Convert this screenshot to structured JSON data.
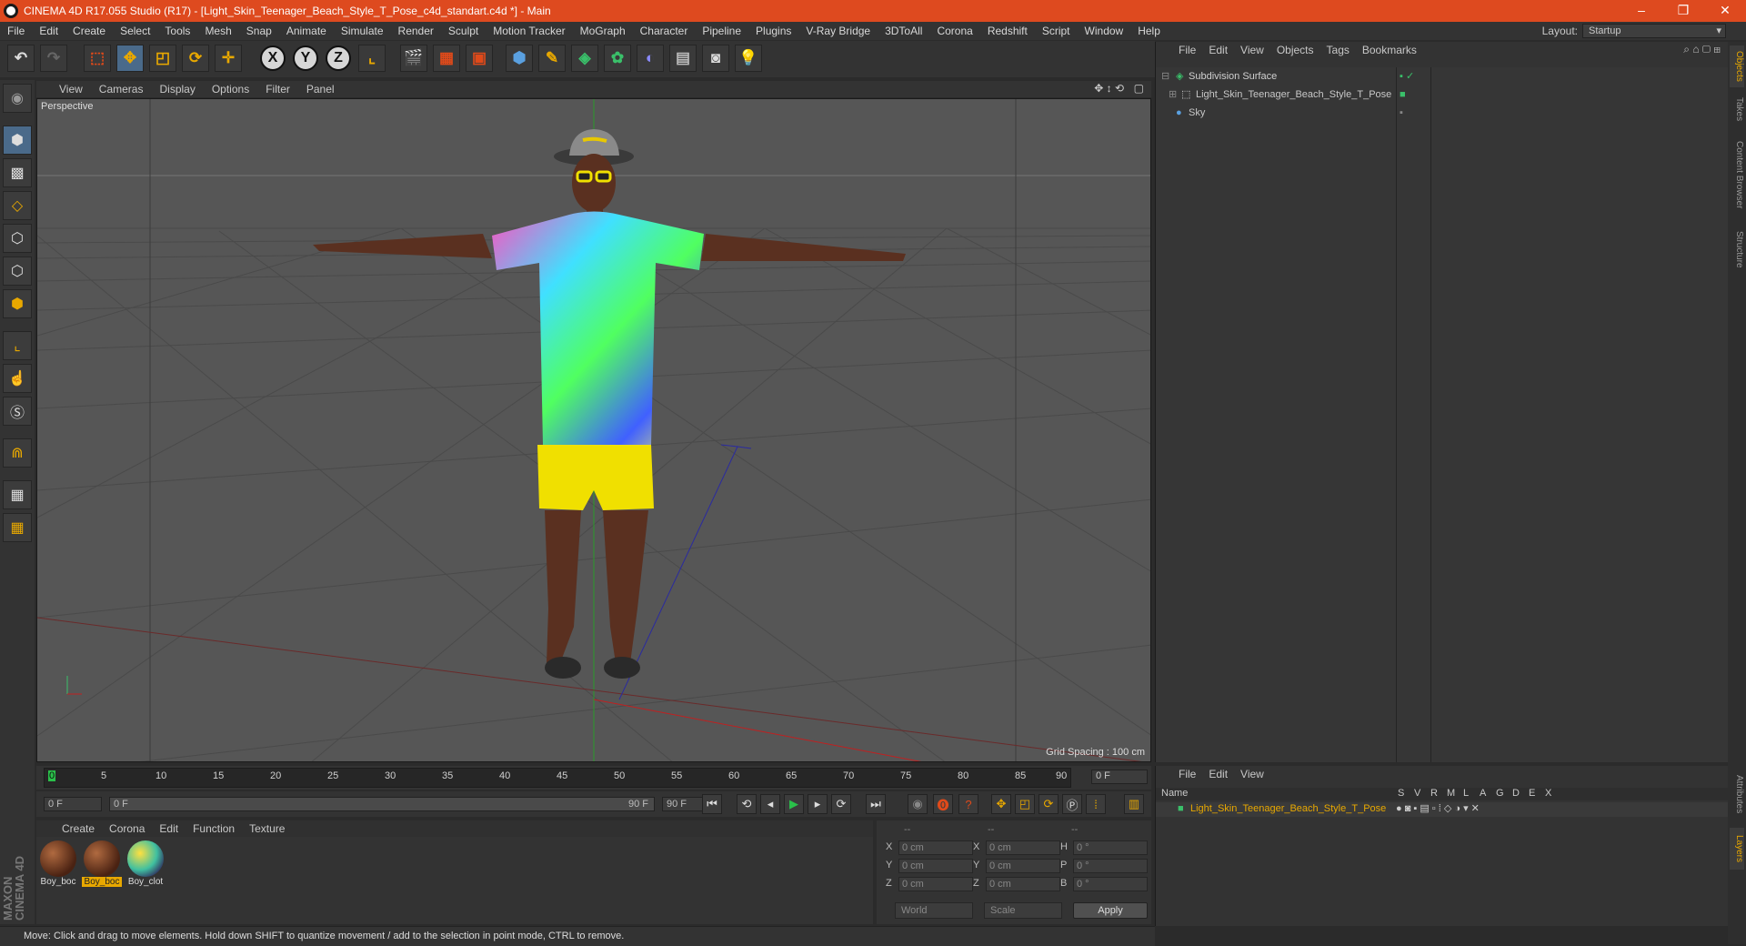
{
  "window": {
    "title": "CINEMA 4D R17.055 Studio (R17) - [Light_Skin_Teenager_Beach_Style_T_Pose_c4d_standart.c4d *] - Main",
    "controls": [
      "–",
      "❐",
      "✕"
    ]
  },
  "menu": [
    "File",
    "Edit",
    "Create",
    "Select",
    "Tools",
    "Mesh",
    "Snap",
    "Animate",
    "Simulate",
    "Render",
    "Sculpt",
    "Motion Tracker",
    "MoGraph",
    "Character",
    "Pipeline",
    "Plugins",
    "V-Ray Bridge",
    "3DToAll",
    "Corona",
    "Redshift",
    "Script",
    "Window",
    "Help"
  ],
  "layout": {
    "label": "Layout:",
    "value": "Startup"
  },
  "toolbar": {
    "axis_x": "X",
    "axis_y": "Y",
    "axis_z": "Z"
  },
  "viewport": {
    "menu": [
      "View",
      "Cameras",
      "Display",
      "Options",
      "Filter",
      "Panel"
    ],
    "label": "Perspective",
    "grid_spacing": "Grid Spacing : 100 cm"
  },
  "timeline": {
    "ticks": [
      "0",
      "5",
      "10",
      "15",
      "20",
      "25",
      "30",
      "35",
      "40",
      "45",
      "50",
      "55",
      "60",
      "65",
      "70",
      "75",
      "80",
      "85",
      "90"
    ],
    "current_frame": "0 F",
    "start_field": "0 F",
    "range_start": "0 F",
    "range_end": "90 F",
    "end_field": "90 F"
  },
  "materials": {
    "menu": [
      "Create",
      "Corona",
      "Edit",
      "Function",
      "Texture"
    ],
    "items": [
      {
        "label": "Boy_boc",
        "selected": false
      },
      {
        "label": "Boy_boc",
        "selected": true
      },
      {
        "label": "Boy_clot",
        "selected": false
      }
    ]
  },
  "coords": {
    "headers": [
      "--",
      "--",
      "--"
    ],
    "rows": [
      {
        "l1": "X",
        "v1": "0 cm",
        "l2": "X",
        "v2": "0 cm",
        "l3": "H",
        "v3": "0 °"
      },
      {
        "l1": "Y",
        "v1": "0 cm",
        "l2": "Y",
        "v2": "0 cm",
        "l3": "P",
        "v3": "0 °"
      },
      {
        "l1": "Z",
        "v1": "0 cm",
        "l2": "Z",
        "v2": "0 cm",
        "l3": "B",
        "v3": "0 °"
      }
    ],
    "world": "World",
    "scale": "Scale",
    "apply": "Apply"
  },
  "status": "Move: Click and drag to move elements. Hold down SHIFT to quantize movement / add to the selection in point mode, CTRL to remove.",
  "objects": {
    "menu": [
      "File",
      "Edit",
      "View",
      "Objects",
      "Tags",
      "Bookmarks"
    ],
    "rows": [
      {
        "name": "Subdivision Surface",
        "color": "#5aa0e0"
      },
      {
        "name": "Light_Skin_Teenager_Beach_Style_T_Pose",
        "color": "#c8c8c8"
      },
      {
        "name": "Sky",
        "color": "#c8c8c8"
      }
    ]
  },
  "layers": {
    "menu": [
      "File",
      "Edit",
      "View"
    ],
    "columns": [
      "Name",
      "S",
      "V",
      "R",
      "M",
      "L",
      "A",
      "G",
      "D",
      "E",
      "X"
    ],
    "rows": [
      {
        "name": "Light_Skin_Teenager_Beach_Style_T_Pose",
        "color": "#e8a800"
      }
    ]
  },
  "side_tabs": [
    "Objects",
    "Takes",
    "Content Browser",
    "Structure",
    "Attributes",
    "Layers"
  ],
  "brand": "MAXON CINEMA 4D"
}
